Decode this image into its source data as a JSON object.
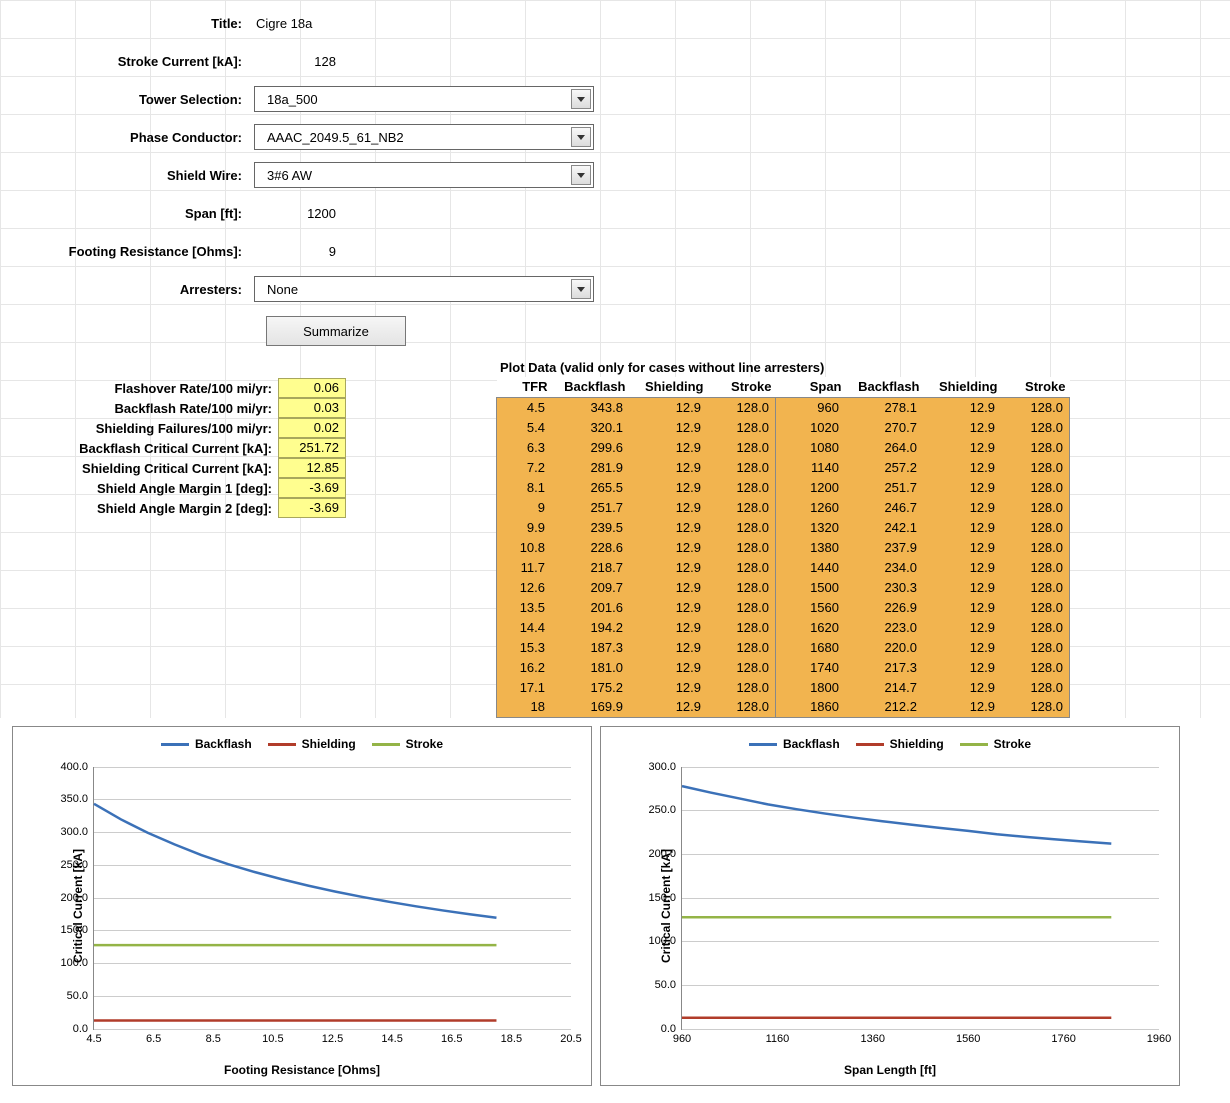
{
  "form": {
    "title_label": "Title:",
    "title_value": "Cigre 18a",
    "stroke_current_label": "Stroke Current [kA]:",
    "stroke_current_value": "128",
    "tower_selection_label": "Tower Selection:",
    "tower_selection_value": "18a_500",
    "phase_conductor_label": "Phase Conductor:",
    "phase_conductor_value": "AAAC_2049.5_61_NB2",
    "shield_wire_label": "Shield Wire:",
    "shield_wire_value": "3#6 AW",
    "span_label": "Span [ft]:",
    "span_value": "1200",
    "footing_resistance_label": "Footing Resistance [Ohms]:",
    "footing_resistance_value": "9",
    "arresters_label": "Arresters:",
    "arresters_value": "None",
    "summarize_button": "Summarize"
  },
  "results": [
    {
      "label": "Flashover Rate/100 mi/yr:",
      "value": "0.06"
    },
    {
      "label": "Backflash Rate/100 mi/yr:",
      "value": "0.03"
    },
    {
      "label": "Shielding Failures/100 mi/yr:",
      "value": "0.02"
    },
    {
      "label": "Backflash Critical Current [kA]:",
      "value": "251.72"
    },
    {
      "label": "Shielding Critical Current [kA]:",
      "value": "12.85"
    },
    {
      "label": "Shield Angle Margin 1 [deg]:",
      "value": "-3.69"
    },
    {
      "label": "Shield Angle Margin 2 [deg]:",
      "value": "-3.69"
    }
  ],
  "plot_data": {
    "title": "Plot Data (valid only for cases without line arresters)",
    "headers": [
      "TFR",
      "Backflash",
      "Shielding",
      "Stroke",
      "Span",
      "Backflash",
      "Shielding",
      "Stroke"
    ],
    "rows": [
      [
        "4.5",
        "343.8",
        "12.9",
        "128.0",
        "960",
        "278.1",
        "12.9",
        "128.0"
      ],
      [
        "5.4",
        "320.1",
        "12.9",
        "128.0",
        "1020",
        "270.7",
        "12.9",
        "128.0"
      ],
      [
        "6.3",
        "299.6",
        "12.9",
        "128.0",
        "1080",
        "264.0",
        "12.9",
        "128.0"
      ],
      [
        "7.2",
        "281.9",
        "12.9",
        "128.0",
        "1140",
        "257.2",
        "12.9",
        "128.0"
      ],
      [
        "8.1",
        "265.5",
        "12.9",
        "128.0",
        "1200",
        "251.7",
        "12.9",
        "128.0"
      ],
      [
        "9",
        "251.7",
        "12.9",
        "128.0",
        "1260",
        "246.7",
        "12.9",
        "128.0"
      ],
      [
        "9.9",
        "239.5",
        "12.9",
        "128.0",
        "1320",
        "242.1",
        "12.9",
        "128.0"
      ],
      [
        "10.8",
        "228.6",
        "12.9",
        "128.0",
        "1380",
        "237.9",
        "12.9",
        "128.0"
      ],
      [
        "11.7",
        "218.7",
        "12.9",
        "128.0",
        "1440",
        "234.0",
        "12.9",
        "128.0"
      ],
      [
        "12.6",
        "209.7",
        "12.9",
        "128.0",
        "1500",
        "230.3",
        "12.9",
        "128.0"
      ],
      [
        "13.5",
        "201.6",
        "12.9",
        "128.0",
        "1560",
        "226.9",
        "12.9",
        "128.0"
      ],
      [
        "14.4",
        "194.2",
        "12.9",
        "128.0",
        "1620",
        "223.0",
        "12.9",
        "128.0"
      ],
      [
        "15.3",
        "187.3",
        "12.9",
        "128.0",
        "1680",
        "220.0",
        "12.9",
        "128.0"
      ],
      [
        "16.2",
        "181.0",
        "12.9",
        "128.0",
        "1740",
        "217.3",
        "12.9",
        "128.0"
      ],
      [
        "17.1",
        "175.2",
        "12.9",
        "128.0",
        "1800",
        "214.7",
        "12.9",
        "128.0"
      ],
      [
        "18",
        "169.9",
        "12.9",
        "128.0",
        "1860",
        "212.2",
        "12.9",
        "128.0"
      ]
    ]
  },
  "chart_data": [
    {
      "type": "line",
      "xlabel": "Footing Resistance [Ohms]",
      "ylabel": "Critical Current [kA]",
      "xlim": [
        4.5,
        20.5
      ],
      "ylim": [
        0,
        400
      ],
      "x_ticks": [
        "4.5",
        "6.5",
        "8.5",
        "10.5",
        "12.5",
        "14.5",
        "16.5",
        "18.5",
        "20.5"
      ],
      "y_ticks": [
        "0.0",
        "50.0",
        "100.0",
        "150.0",
        "200.0",
        "250.0",
        "300.0",
        "350.0",
        "400.0"
      ],
      "x": [
        4.5,
        5.4,
        6.3,
        7.2,
        8.1,
        9,
        9.9,
        10.8,
        11.7,
        12.6,
        13.5,
        14.4,
        15.3,
        16.2,
        17.1,
        18
      ],
      "series": [
        {
          "name": "Backflash",
          "color": "#3b71b8",
          "values": [
            343.8,
            320.1,
            299.6,
            281.9,
            265.5,
            251.7,
            239.5,
            228.6,
            218.7,
            209.7,
            201.6,
            194.2,
            187.3,
            181.0,
            175.2,
            169.9
          ]
        },
        {
          "name": "Shielding",
          "color": "#b13c2a",
          "values": [
            12.9,
            12.9,
            12.9,
            12.9,
            12.9,
            12.9,
            12.9,
            12.9,
            12.9,
            12.9,
            12.9,
            12.9,
            12.9,
            12.9,
            12.9,
            12.9
          ]
        },
        {
          "name": "Stroke",
          "color": "#94b447",
          "values": [
            128.0,
            128.0,
            128.0,
            128.0,
            128.0,
            128.0,
            128.0,
            128.0,
            128.0,
            128.0,
            128.0,
            128.0,
            128.0,
            128.0,
            128.0,
            128.0
          ]
        }
      ]
    },
    {
      "type": "line",
      "xlabel": "Span Length [ft]",
      "ylabel": "Critical Current [kA]",
      "xlim": [
        960,
        1960
      ],
      "ylim": [
        0,
        300
      ],
      "x_ticks": [
        "960",
        "1160",
        "1360",
        "1560",
        "1760",
        "1960"
      ],
      "y_ticks": [
        "0.0",
        "50.0",
        "100.0",
        "150.0",
        "200.0",
        "250.0",
        "300.0"
      ],
      "x": [
        960,
        1020,
        1080,
        1140,
        1200,
        1260,
        1320,
        1380,
        1440,
        1500,
        1560,
        1620,
        1680,
        1740,
        1800,
        1860
      ],
      "series": [
        {
          "name": "Backflash",
          "color": "#3b71b8",
          "values": [
            278.1,
            270.7,
            264.0,
            257.2,
            251.7,
            246.7,
            242.1,
            237.9,
            234.0,
            230.3,
            226.9,
            223.0,
            220.0,
            217.3,
            214.7,
            212.2
          ]
        },
        {
          "name": "Shielding",
          "color": "#b13c2a",
          "values": [
            12.9,
            12.9,
            12.9,
            12.9,
            12.9,
            12.9,
            12.9,
            12.9,
            12.9,
            12.9,
            12.9,
            12.9,
            12.9,
            12.9,
            12.9,
            12.9
          ]
        },
        {
          "name": "Stroke",
          "color": "#94b447",
          "values": [
            128.0,
            128.0,
            128.0,
            128.0,
            128.0,
            128.0,
            128.0,
            128.0,
            128.0,
            128.0,
            128.0,
            128.0,
            128.0,
            128.0,
            128.0,
            128.0
          ]
        }
      ]
    }
  ]
}
